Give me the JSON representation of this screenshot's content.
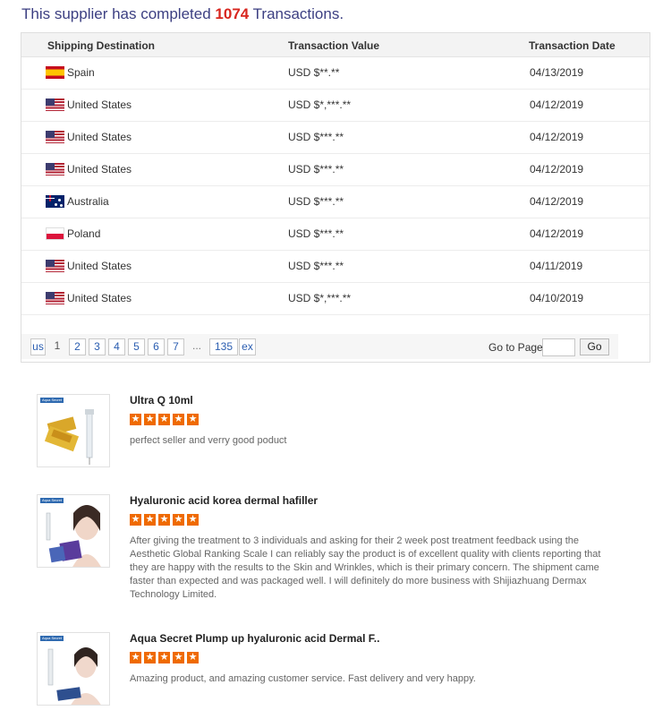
{
  "header": {
    "prefix": "This supplier has completed",
    "count": "1074",
    "suffix": "Transactions."
  },
  "table": {
    "columns": [
      "Shipping Destination",
      "Transaction Value",
      "Transaction Date"
    ],
    "rows": [
      {
        "country": "Spain",
        "flag": "es",
        "value": "USD $**.**",
        "date": "04/13/2019"
      },
      {
        "country": "United States",
        "flag": "us",
        "value": "USD $*,***.**",
        "date": "04/12/2019"
      },
      {
        "country": "United States",
        "flag": "us",
        "value": "USD $***.**",
        "date": "04/12/2019"
      },
      {
        "country": "United States",
        "flag": "us",
        "value": "USD $***.**",
        "date": "04/12/2019"
      },
      {
        "country": "Australia",
        "flag": "au",
        "value": "USD $***.**",
        "date": "04/12/2019"
      },
      {
        "country": "Poland",
        "flag": "pl",
        "value": "USD $***.**",
        "date": "04/12/2019"
      },
      {
        "country": "United States",
        "flag": "us",
        "value": "USD $***.**",
        "date": "04/11/2019"
      },
      {
        "country": "United States",
        "flag": "us",
        "value": "USD $*,***.**",
        "date": "04/10/2019"
      }
    ]
  },
  "pagination": {
    "prev": "us",
    "current": "1",
    "pages": [
      "2",
      "3",
      "4",
      "5",
      "6",
      "7"
    ],
    "ellipsis": "...",
    "last": "135",
    "next": "ex",
    "goto_label": "Go to Page",
    "goto_value": "",
    "go_button": "Go"
  },
  "reviews": [
    {
      "title": "Ultra Q 10ml",
      "rating": 5,
      "text": "perfect seller and verry good poduct",
      "thumb_brand": "Aqua Secret"
    },
    {
      "title": "Hyaluronic acid korea dermal hafiller",
      "rating": 5,
      "text": "After giving the treatment to 3 individuals and asking for their 2 week post treatment feedback using the Aesthetic Global Ranking Scale I can reliably say the product is of excellent quality with clients reporting that they are happy with the results to the Skin and Wrinkles, which is their primary concern.  The shipment came faster than expected and was packaged well.  I will definitely do more business with Shijiazhuang Dermax Technology Limited.",
      "thumb_brand": "Aqua Secret"
    },
    {
      "title": "Aqua Secret Plump up hyaluronic acid Dermal F..",
      "rating": 5,
      "text": "Amazing product, and amazing customer service. Fast delivery and very happy.",
      "thumb_brand": "Aqua Secret"
    }
  ],
  "colors": {
    "headline": "#3c3f82",
    "count": "#d8261f",
    "link": "#2a5db0",
    "star": "#ef6a00"
  }
}
